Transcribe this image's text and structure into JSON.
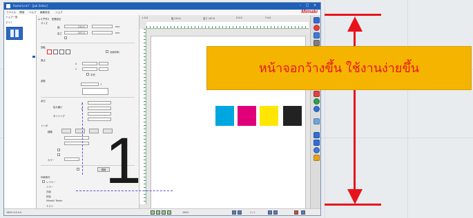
{
  "window": {
    "title": "RasterLink7 - [Job Editor]",
    "brand": "Mimaki",
    "controls": [
      "–",
      "□",
      "×"
    ]
  },
  "menu": [
    "ファイル",
    "環境",
    "ヘルプ",
    "編集設定",
    "ジョブ"
  ],
  "job_panel": {
    "header": "ジョブ一覧",
    "tab": "すべて",
    "thumbnail_label": "1"
  },
  "settings": {
    "section_layout": "レイアウト",
    "tab_label": "配置設定",
    "size_label": "サイズ",
    "width_label": "幅",
    "height_label": "高さ",
    "width_value": "210.0",
    "height_value": "297.0",
    "unit": "mm",
    "rotate_label": "回転",
    "origin_label": "原点",
    "x_label": "X",
    "y_label": "Y",
    "x_value": "0.0",
    "y_value": "0.0",
    "center_label": "中央",
    "fit_label": "全面印刷",
    "copies_label": "部数",
    "copies_value": "1",
    "margin_label": "余白",
    "margin_top_label": "上",
    "margin_bottom_label": "下",
    "margin_value": "0.0",
    "mark_label": "トンボ",
    "mark_type_label": "種類",
    "scale_label": "拡大縮小",
    "tile_label": "タイリング",
    "color_label": "カラー",
    "apply_button": "適用",
    "footer_section": "印刷条件",
    "option1": "レイヤー",
    "option2": "ミラー",
    "option3": "白版",
    "option4": "特色",
    "option5": "Mimaki Tester",
    "option6": "テスト"
  },
  "preview": {
    "topbar": [
      "L  0.0",
      "幅  210.0",
      "高さ  297.0",
      "X  0.0",
      "Y  0.0"
    ],
    "big_label": "1",
    "cmyk_colors": [
      "#00a6e0",
      "#e0007a",
      "#ffe600",
      "#222222"
    ]
  },
  "toolbar_icons": [
    "#2f6fd6",
    "#e24040",
    "#3a7ad8",
    "#7d7d7d",
    "#4a9be0",
    "#e24040",
    "#2aa14a",
    "#2f6fd6",
    "#6aa7e0",
    "#2f6fd6",
    "#2f6fd6",
    "#3a7ad8",
    "#e8a020"
  ],
  "bottombar": {
    "status": "100%  0.0  0.0",
    "zoom": "100%",
    "page": "1 / 1"
  },
  "overlay": {
    "banner_text": "หน้าจอกว้างขึ้น ใช้งานง่ายขึ้น",
    "banner_color": "#f5b400",
    "text_color": "#e8141b",
    "arrow_color": "#e8141b"
  }
}
